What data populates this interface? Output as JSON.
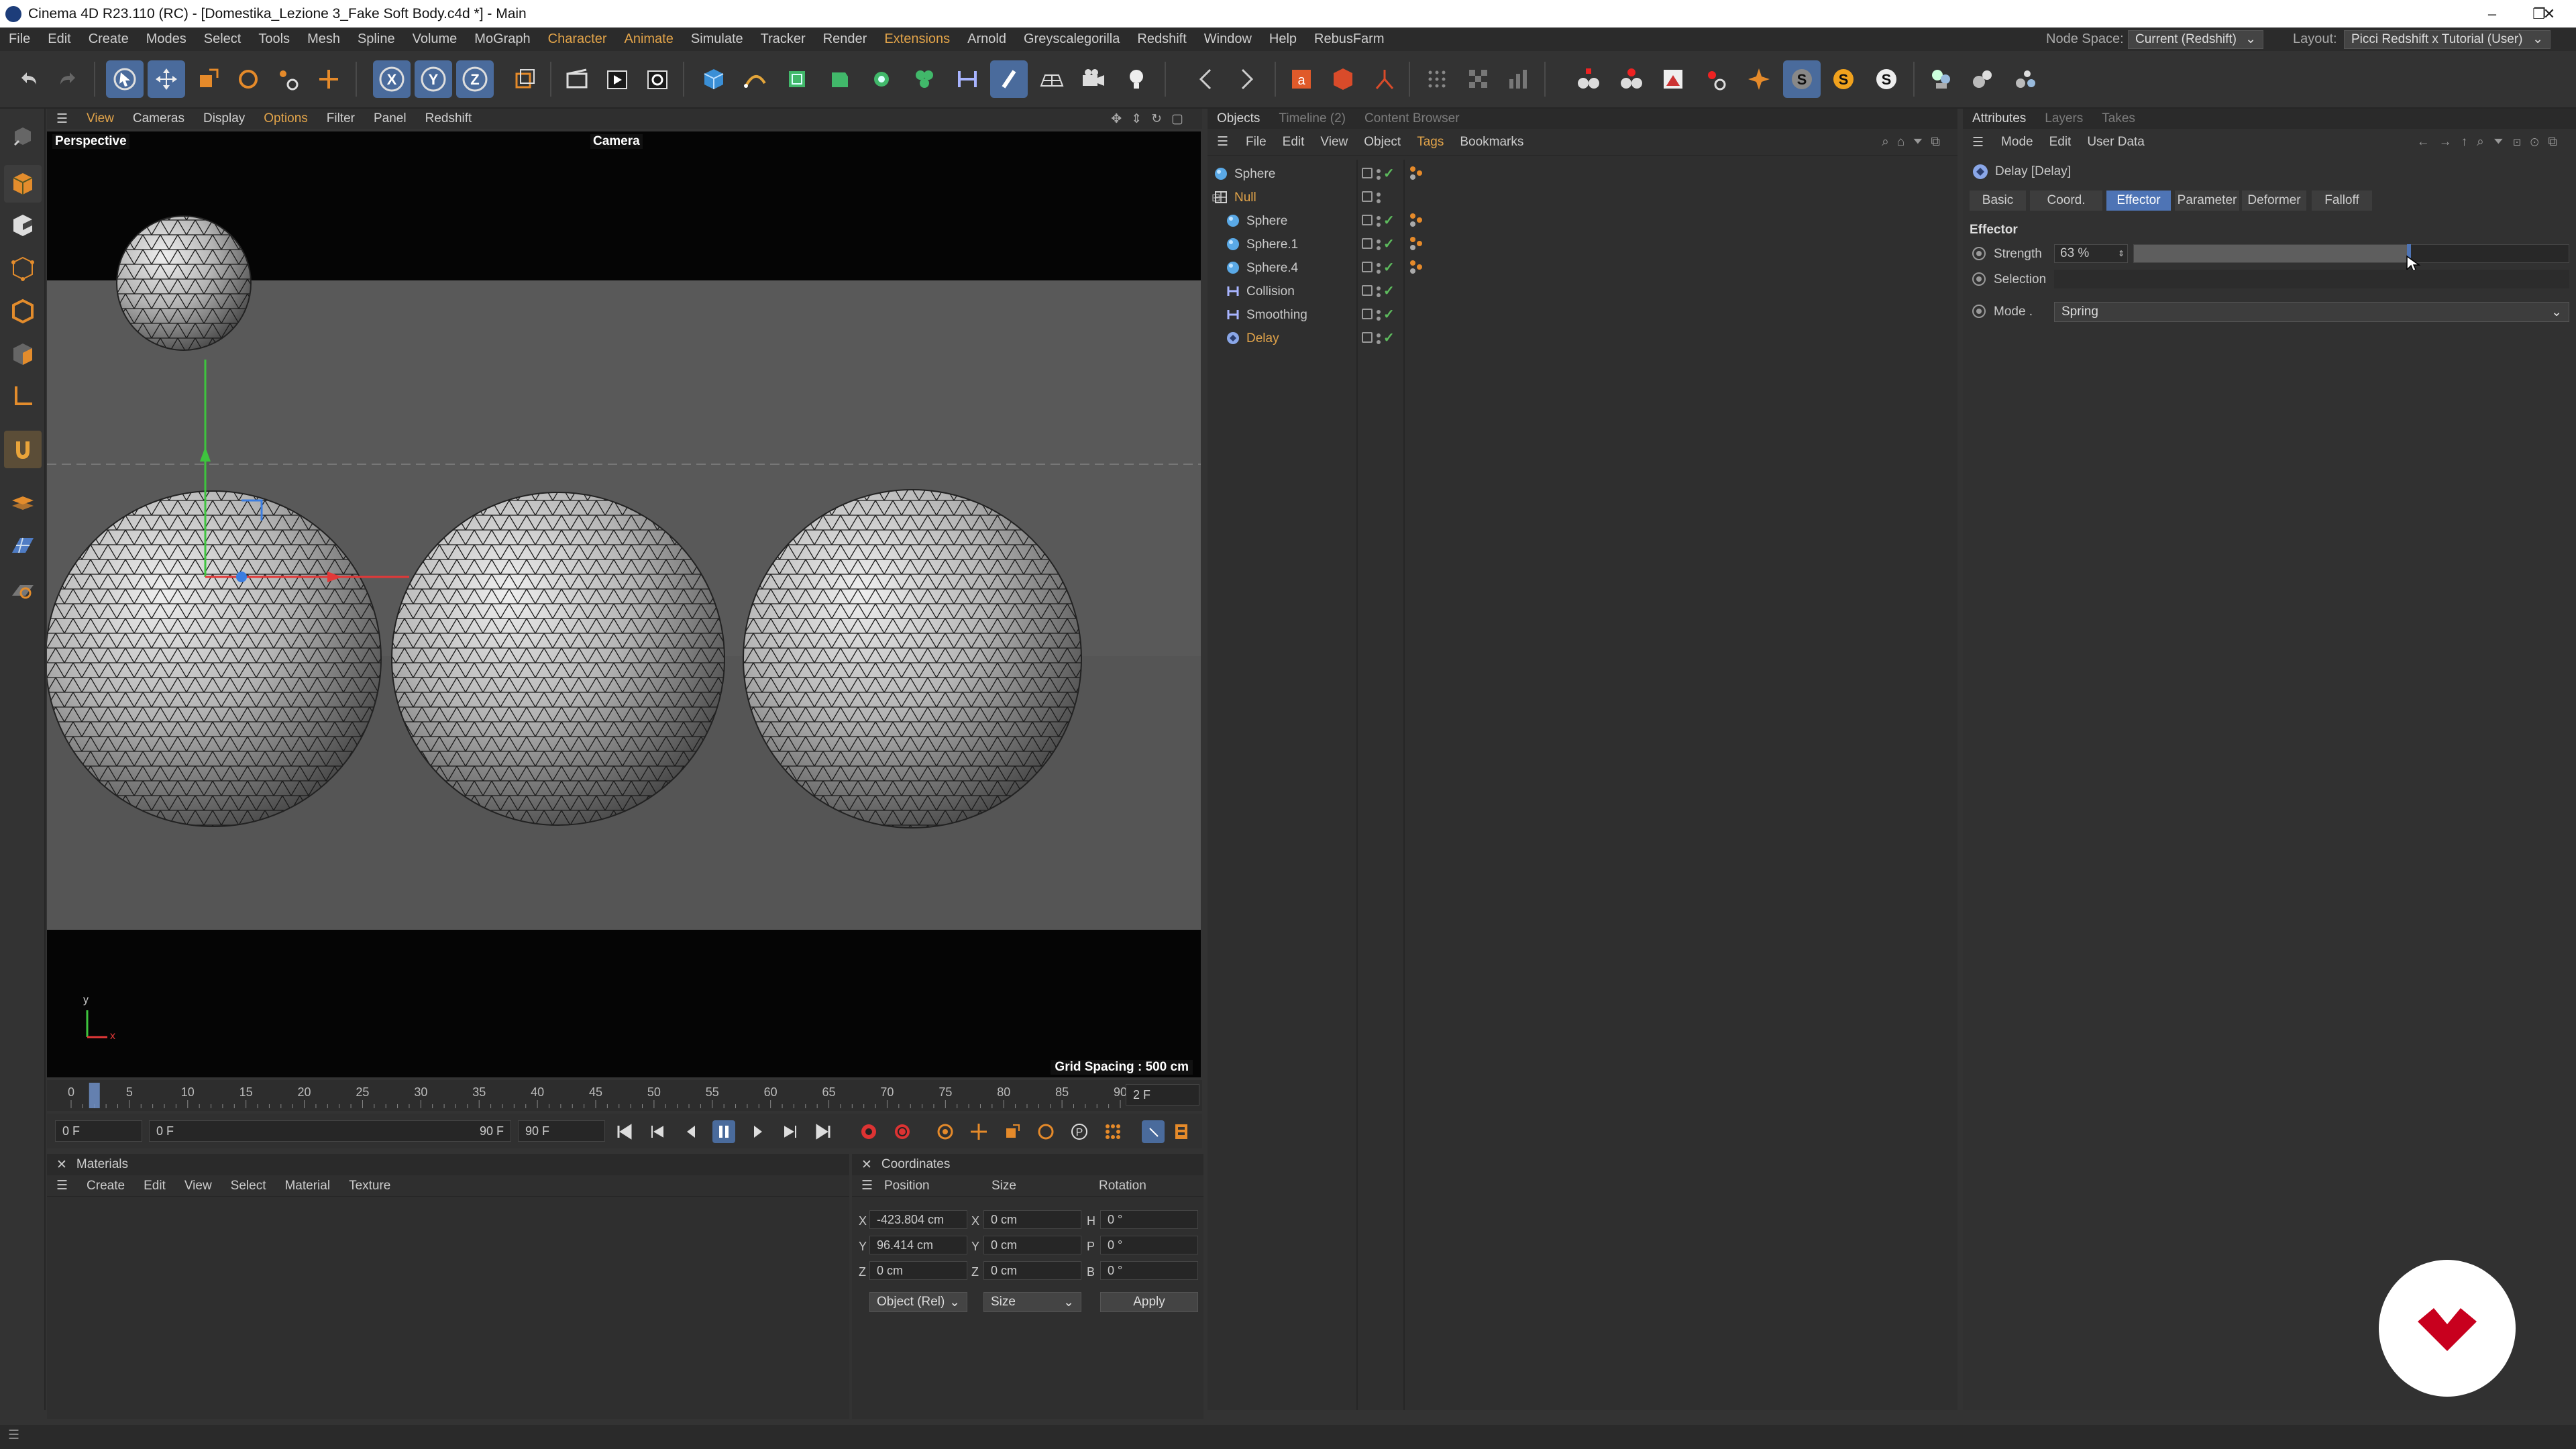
{
  "window": {
    "title": "Cinema 4D R23.110 (RC) - [Domestika_Lezione 3_Fake Soft Body.c4d *] - Main",
    "minimize": "–",
    "restore": "❐",
    "close": "✕"
  },
  "menubar": {
    "items": [
      "File",
      "Edit",
      "Create",
      "Modes",
      "Select",
      "Tools",
      "Mesh",
      "Spline",
      "Volume",
      "MoGraph",
      "Character",
      "Animate",
      "Simulate",
      "Tracker",
      "Render",
      "Extensions",
      "Arnold",
      "Greyscalegorilla",
      "Redshift",
      "Window",
      "Help",
      "RebusFarm"
    ],
    "highlighted": [
      "Character",
      "Animate",
      "Extensions"
    ],
    "node_space_label": "Node Space:",
    "node_space_value": "Current (Redshift)",
    "layout_label": "Layout:",
    "layout_value": "Picci Redshift x Tutorial (User)"
  },
  "viewport": {
    "menu": [
      "View",
      "Cameras",
      "Display",
      "Options",
      "Filter",
      "Panel",
      "Redshift"
    ],
    "highlighted": [
      "View",
      "Options"
    ],
    "label": "Perspective",
    "camera": "Camera",
    "grid_spacing": "Grid Spacing : 500 cm",
    "axis_y": "y",
    "axis_x": "x"
  },
  "timeline": {
    "ticks": [
      "0",
      "5",
      "10",
      "15",
      "20",
      "25",
      "30",
      "35",
      "40",
      "45",
      "50",
      "55",
      "60",
      "65",
      "70",
      "75",
      "80",
      "85",
      "90"
    ],
    "current_frame_label": "2 F",
    "start_field": "0 F",
    "range_start": "0 F",
    "range_end": "90 F",
    "end_field": "90 F"
  },
  "materials": {
    "title": "Materials",
    "menu": [
      "Create",
      "Edit",
      "View",
      "Select",
      "Material",
      "Texture"
    ]
  },
  "coordinates": {
    "title": "Coordinates",
    "headers": [
      "Position",
      "Size",
      "Rotation"
    ],
    "rows": [
      {
        "axis": "X",
        "pos": "-423.804 cm",
        "size_axis": "X",
        "size": "0 cm",
        "rot_axis": "H",
        "rot": "0 °"
      },
      {
        "axis": "Y",
        "pos": "96.414 cm",
        "size_axis": "Y",
        "size": "0 cm",
        "rot_axis": "P",
        "rot": "0 °"
      },
      {
        "axis": "Z",
        "pos": "0 cm",
        "size_axis": "Z",
        "size": "0 cm",
        "rot_axis": "B",
        "rot": "0 °"
      }
    ],
    "mode": "Object (Rel)",
    "size_mode": "Size",
    "apply": "Apply"
  },
  "objects": {
    "tabs": [
      "Objects",
      "Timeline (2)",
      "Content Browser"
    ],
    "menu": [
      "File",
      "Edit",
      "View",
      "Object",
      "Tags",
      "Bookmarks"
    ],
    "highlighted_menu": "Tags",
    "items": [
      {
        "name": "Sphere",
        "indent": 0,
        "icon": "sphere",
        "tags": true
      },
      {
        "name": "Null",
        "indent": 0,
        "icon": "null",
        "tags": false
      },
      {
        "name": "Sphere",
        "indent": 1,
        "icon": "sphere",
        "tags": true
      },
      {
        "name": "Sphere.1",
        "indent": 1,
        "icon": "sphere",
        "tags": true
      },
      {
        "name": "Sphere.4",
        "indent": 1,
        "icon": "sphere",
        "tags": true
      },
      {
        "name": "Collision",
        "indent": 1,
        "icon": "deformer",
        "tags": false
      },
      {
        "name": "Smoothing",
        "indent": 1,
        "icon": "deformer",
        "tags": false
      },
      {
        "name": "Delay",
        "indent": 1,
        "icon": "effector",
        "tags": false
      }
    ]
  },
  "attributes": {
    "tabs": [
      "Attributes",
      "Layers",
      "Takes"
    ],
    "menu": [
      "Mode",
      "Edit",
      "User Data"
    ],
    "object_title": "Delay [Delay]",
    "subtabs": [
      "Basic",
      "Coord.",
      "Effector",
      "Parameter",
      "Deformer",
      "Falloff"
    ],
    "active_subtab": "Effector",
    "section": "Effector",
    "strength_label": "Strength",
    "strength_value": "63 %",
    "strength_fraction": 0.63,
    "selection_label": "Selection",
    "mode_label": "Mode .",
    "mode_value": "Spring"
  },
  "colors": {
    "accent_blue": "#4e74b5",
    "highlight_orange": "#e2a44a",
    "check_green": "#5dbb5d",
    "logo_red": "#c8001e"
  }
}
